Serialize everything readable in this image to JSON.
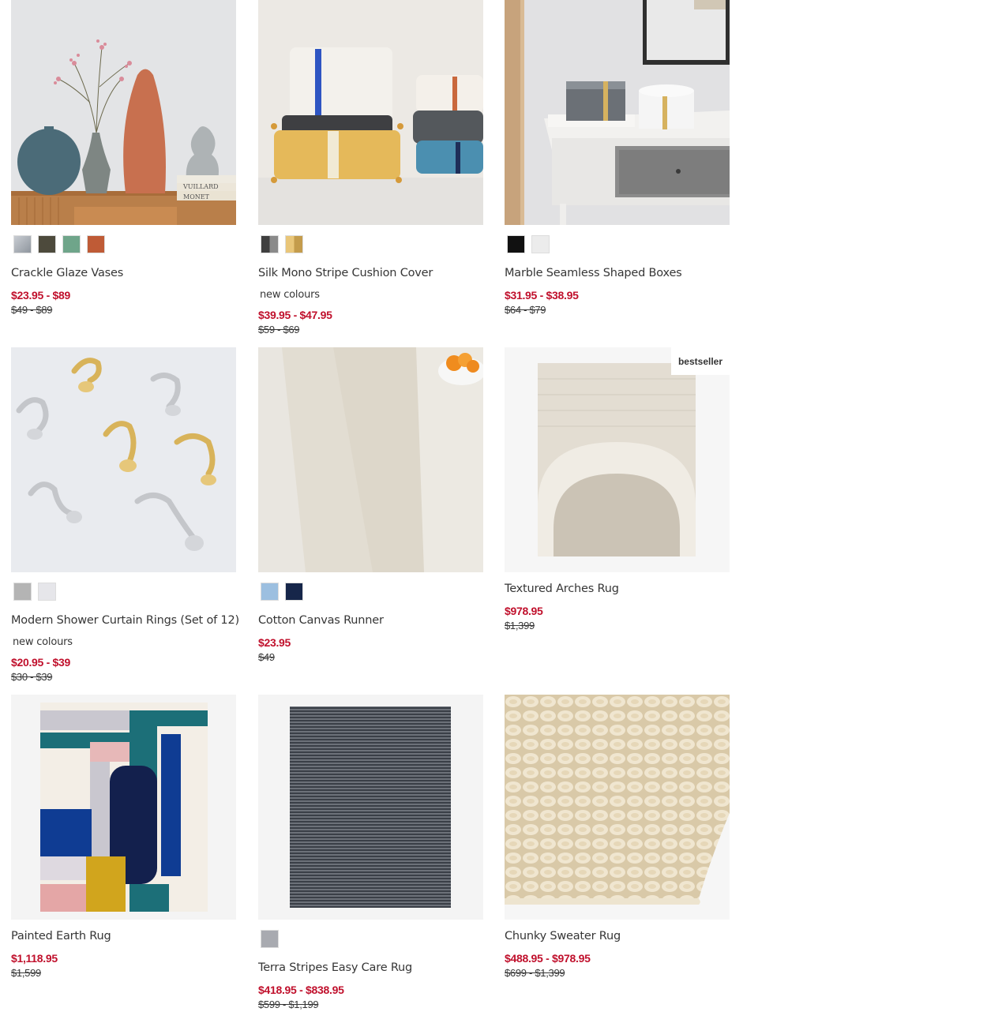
{
  "products": [
    {
      "name": "Crackle Glaze Vases",
      "price": "$23.95 - $89",
      "original": "$49 - $89",
      "new_colours": "",
      "badge": "",
      "swatches": [
        "#a3a9b1",
        "#4d4a3c",
        "#6fa58a",
        "#bf5b36"
      ]
    },
    {
      "name": "Silk Mono Stripe Cushion Cover",
      "price": "$39.95 - $47.95",
      "original": "$59 - $69",
      "new_colours": "new colours",
      "badge": "",
      "swatches": [
        "#5a5a5a",
        "#d5b46f"
      ]
    },
    {
      "name": "Marble Seamless Shaped Boxes",
      "price": "$31.95 - $38.95",
      "original": "$64 - $79",
      "new_colours": "",
      "badge": "",
      "swatches": [
        "#111111",
        "#ececec"
      ]
    },
    {
      "name": "Modern Shower Curtain Rings (Set of 12)",
      "price": "$20.95 - $39",
      "original": "$30 - $39",
      "new_colours": "new colours",
      "badge": "",
      "swatches": [
        "#b4b4b4",
        "#e6e6ea"
      ]
    },
    {
      "name": "Cotton Canvas Runner",
      "price": "$23.95",
      "original": "$49",
      "new_colours": "",
      "badge": "",
      "swatches": [
        "#9cbfe0",
        "#16264a"
      ]
    },
    {
      "name": "Textured Arches Rug",
      "price": "$978.95",
      "original": "$1,399",
      "new_colours": "",
      "badge": "bestseller",
      "swatches": []
    },
    {
      "name": "Painted Earth Rug",
      "price": "$1,118.95",
      "original": "$1,599",
      "new_colours": "",
      "badge": "",
      "swatches": []
    },
    {
      "name": "Terra Stripes Easy Care Rug",
      "price": "$418.95 - $838.95",
      "original": "$599 - $1,199",
      "new_colours": "",
      "badge": "",
      "swatches": [
        "#a8aab0"
      ]
    },
    {
      "name": "Chunky Sweater Rug",
      "price": "$488.95 - $978.95",
      "original": "$699 - $1,399",
      "new_colours": "",
      "badge": "",
      "swatches": []
    }
  ],
  "image_labels": {
    "book_spine_1": "VUILLARD",
    "book_spine_2": "MONET"
  }
}
